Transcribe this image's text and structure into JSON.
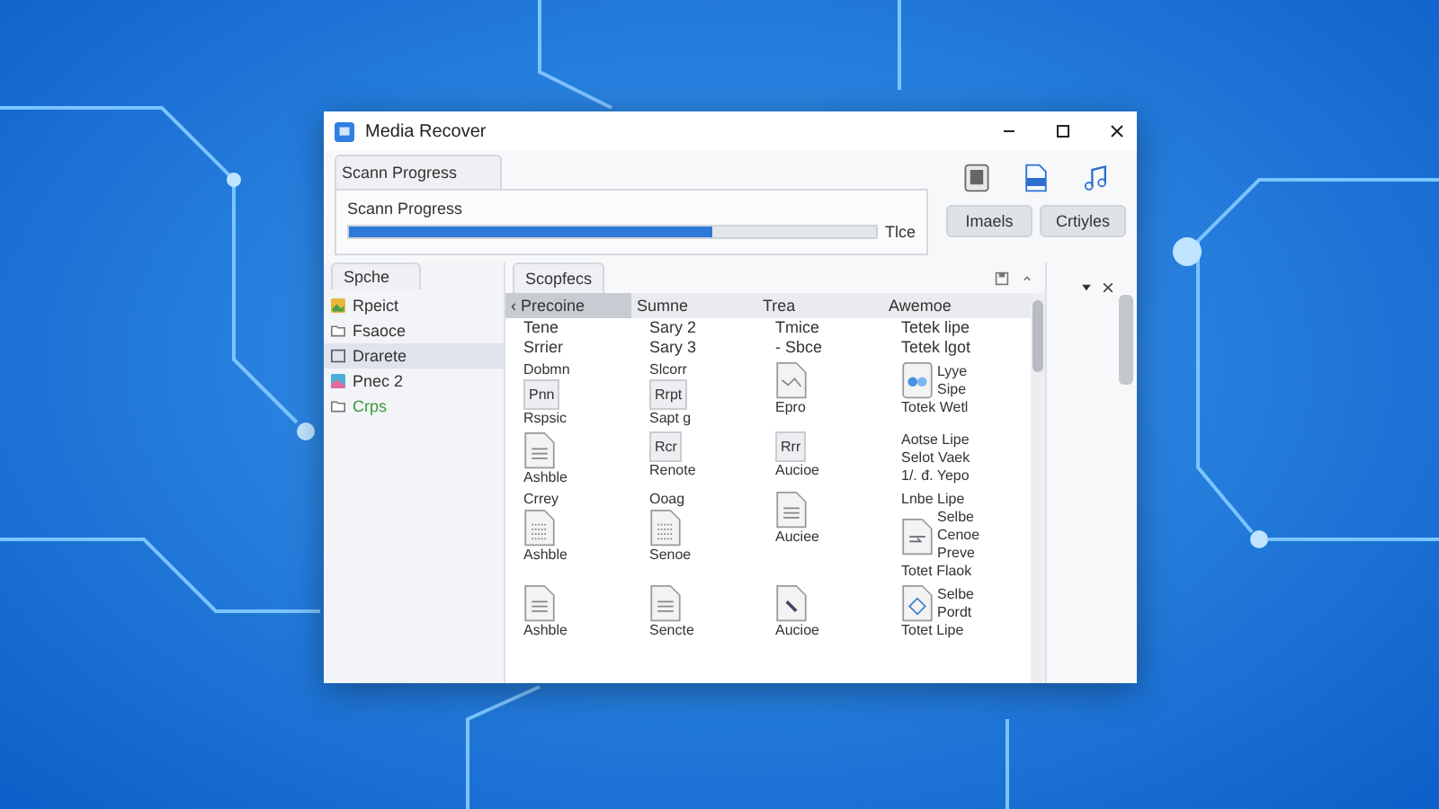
{
  "window": {
    "title": "Media Recover"
  },
  "scan": {
    "tab": "Scann Progress",
    "label": "Scann Progress",
    "level": 0.69,
    "reading": "Tlce"
  },
  "toolbar": {
    "buttons": [
      "Imaels",
      "Crtiyles"
    ]
  },
  "sidebar": {
    "tab": "Spche",
    "items": [
      {
        "label": "Rpeict",
        "kind": "project",
        "selected": false,
        "color": "#333333"
      },
      {
        "label": "Fsaoce",
        "kind": "folder",
        "selected": false,
        "color": "#333333"
      },
      {
        "label": "Drarete",
        "kind": "drive",
        "selected": true,
        "color": "#333333"
      },
      {
        "label": "Pnec 2",
        "kind": "image",
        "selected": false,
        "color": "#333333"
      },
      {
        "label": "Crps",
        "kind": "folder",
        "selected": false,
        "color": "#3a9a3a"
      }
    ]
  },
  "results": {
    "tab": "Scopfecs",
    "columns": [
      {
        "label": "‹ Precoine",
        "selected": true
      },
      {
        "label": "Sumne",
        "selected": false
      },
      {
        "label": "Trea",
        "selected": false
      },
      {
        "label": "Awemoe",
        "selected": false
      }
    ],
    "text_rows": [
      [
        "Tene",
        "Sary 2",
        "Tmice",
        "Tetek lipe"
      ],
      [
        "Srrier",
        "Sary 3",
        "- Sbce",
        "Tetek lgot"
      ]
    ],
    "grid_rows": [
      [
        {
          "top": "Dobmn",
          "kind": "badge",
          "badge": "Pnn",
          "caption": "Rspsic"
        },
        {
          "top": "Slcorr",
          "kind": "badge",
          "badge": "Rrpt",
          "caption": "Sapt g"
        },
        {
          "kind": "image",
          "caption": "Epro"
        },
        {
          "kind": "photo",
          "side": [
            "Lyye",
            "Sipe"
          ],
          "caption": "Totek Wetl"
        }
      ],
      [
        {
          "kind": "lines",
          "caption": "Ashble"
        },
        {
          "kind": "badge",
          "badge": "Rcr",
          "caption": "Renote"
        },
        {
          "kind": "badge",
          "badge": "Rrr",
          "caption": "Aucioe"
        },
        {
          "kind": "text",
          "side": [
            "Aotse Lipe",
            "Selot Vaek",
            "1/. đ. Yepo"
          ]
        }
      ],
      [
        {
          "top": "Crrey",
          "kind": "dotted",
          "caption": "Ashble"
        },
        {
          "top": "Ooag",
          "kind": "dotted",
          "caption": "Senoe"
        },
        {
          "kind": "lines",
          "caption": "Auciee"
        },
        {
          "top": "Lnbe Lipe",
          "kind": "arrow",
          "side": [
            "Selbe",
            "Cenoe",
            "Preve"
          ],
          "caption": "Totet Flaok"
        }
      ],
      [
        {
          "kind": "lines",
          "caption": "Ashble"
        },
        {
          "kind": "lines",
          "caption": "Sencte"
        },
        {
          "kind": "pen",
          "caption": "Aucioe"
        },
        {
          "kind": "diamond",
          "side": [
            "Selbe",
            "Pordt"
          ],
          "caption": "Totet Lipe"
        }
      ]
    ]
  }
}
